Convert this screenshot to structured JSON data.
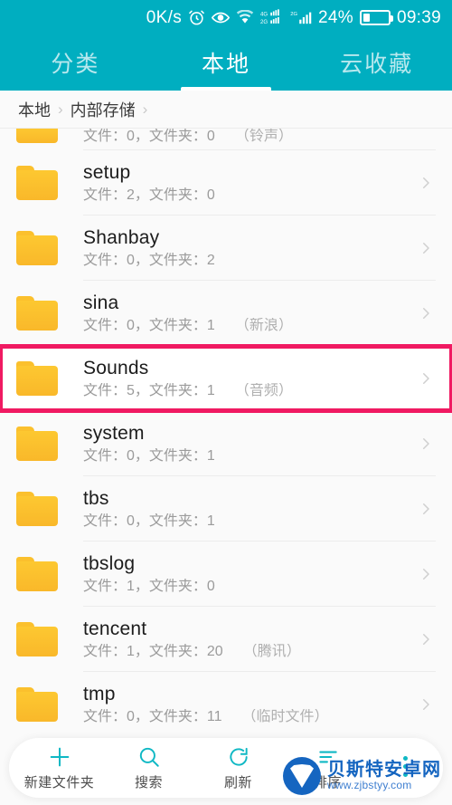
{
  "statusbar": {
    "network_speed": "0K/s",
    "battery_percent": "24%",
    "time": "09:39",
    "signal_4g_label": "4G",
    "signal_2g_label": "2G",
    "icons": [
      "alarm-icon",
      "eye-icon",
      "wifi-icon",
      "signal-4g-icon",
      "signal-2g-icon",
      "battery-icon"
    ]
  },
  "tabs": [
    {
      "label": "分类",
      "active": false
    },
    {
      "label": "本地",
      "active": true
    },
    {
      "label": "云收藏",
      "active": false
    }
  ],
  "breadcrumb": {
    "items": [
      "本地",
      "内部存储"
    ],
    "separator": "›"
  },
  "files": [
    {
      "name": "",
      "info": "文件：0，文件夹：0",
      "alias": "（铃声）",
      "clipped": true,
      "highlight": false
    },
    {
      "name": "setup",
      "info": "文件：2，文件夹：0",
      "alias": "",
      "clipped": false,
      "highlight": false
    },
    {
      "name": "Shanbay",
      "info": "文件：0，文件夹：2",
      "alias": "",
      "clipped": false,
      "highlight": false
    },
    {
      "name": "sina",
      "info": "文件：0，文件夹：1",
      "alias": "（新浪）",
      "clipped": false,
      "highlight": false
    },
    {
      "name": "Sounds",
      "info": "文件：5，文件夹：1",
      "alias": "（音频）",
      "clipped": false,
      "highlight": true
    },
    {
      "name": "system",
      "info": "文件：0，文件夹：1",
      "alias": "",
      "clipped": false,
      "highlight": false
    },
    {
      "name": "tbs",
      "info": "文件：0，文件夹：1",
      "alias": "",
      "clipped": false,
      "highlight": false
    },
    {
      "name": "tbslog",
      "info": "文件：1，文件夹：0",
      "alias": "",
      "clipped": false,
      "highlight": false
    },
    {
      "name": "tencent",
      "info": "文件：1，文件夹：20",
      "alias": "（腾讯）",
      "clipped": false,
      "highlight": false
    },
    {
      "name": "tmp",
      "info": "文件：0，文件夹：11",
      "alias": "（临时文件）",
      "clipped": false,
      "highlight": false
    }
  ],
  "toolbar": [
    {
      "label": "新建文件夹",
      "icon": "plus-icon"
    },
    {
      "label": "搜索",
      "icon": "search-icon"
    },
    {
      "label": "刷新",
      "icon": "refresh-icon"
    },
    {
      "label": "排序",
      "icon": "sort-icon"
    },
    {
      "label": "",
      "icon": "more-vertical-icon"
    }
  ],
  "watermark": {
    "site_name": "贝斯特安卓网",
    "url": "www.zjbstyy.com"
  },
  "colors": {
    "accent_teal": "#00AEC0",
    "folder_amber": "#FBC02D",
    "highlight_pink": "#F01A62",
    "toolbar_icon": "#0FB8C4"
  }
}
